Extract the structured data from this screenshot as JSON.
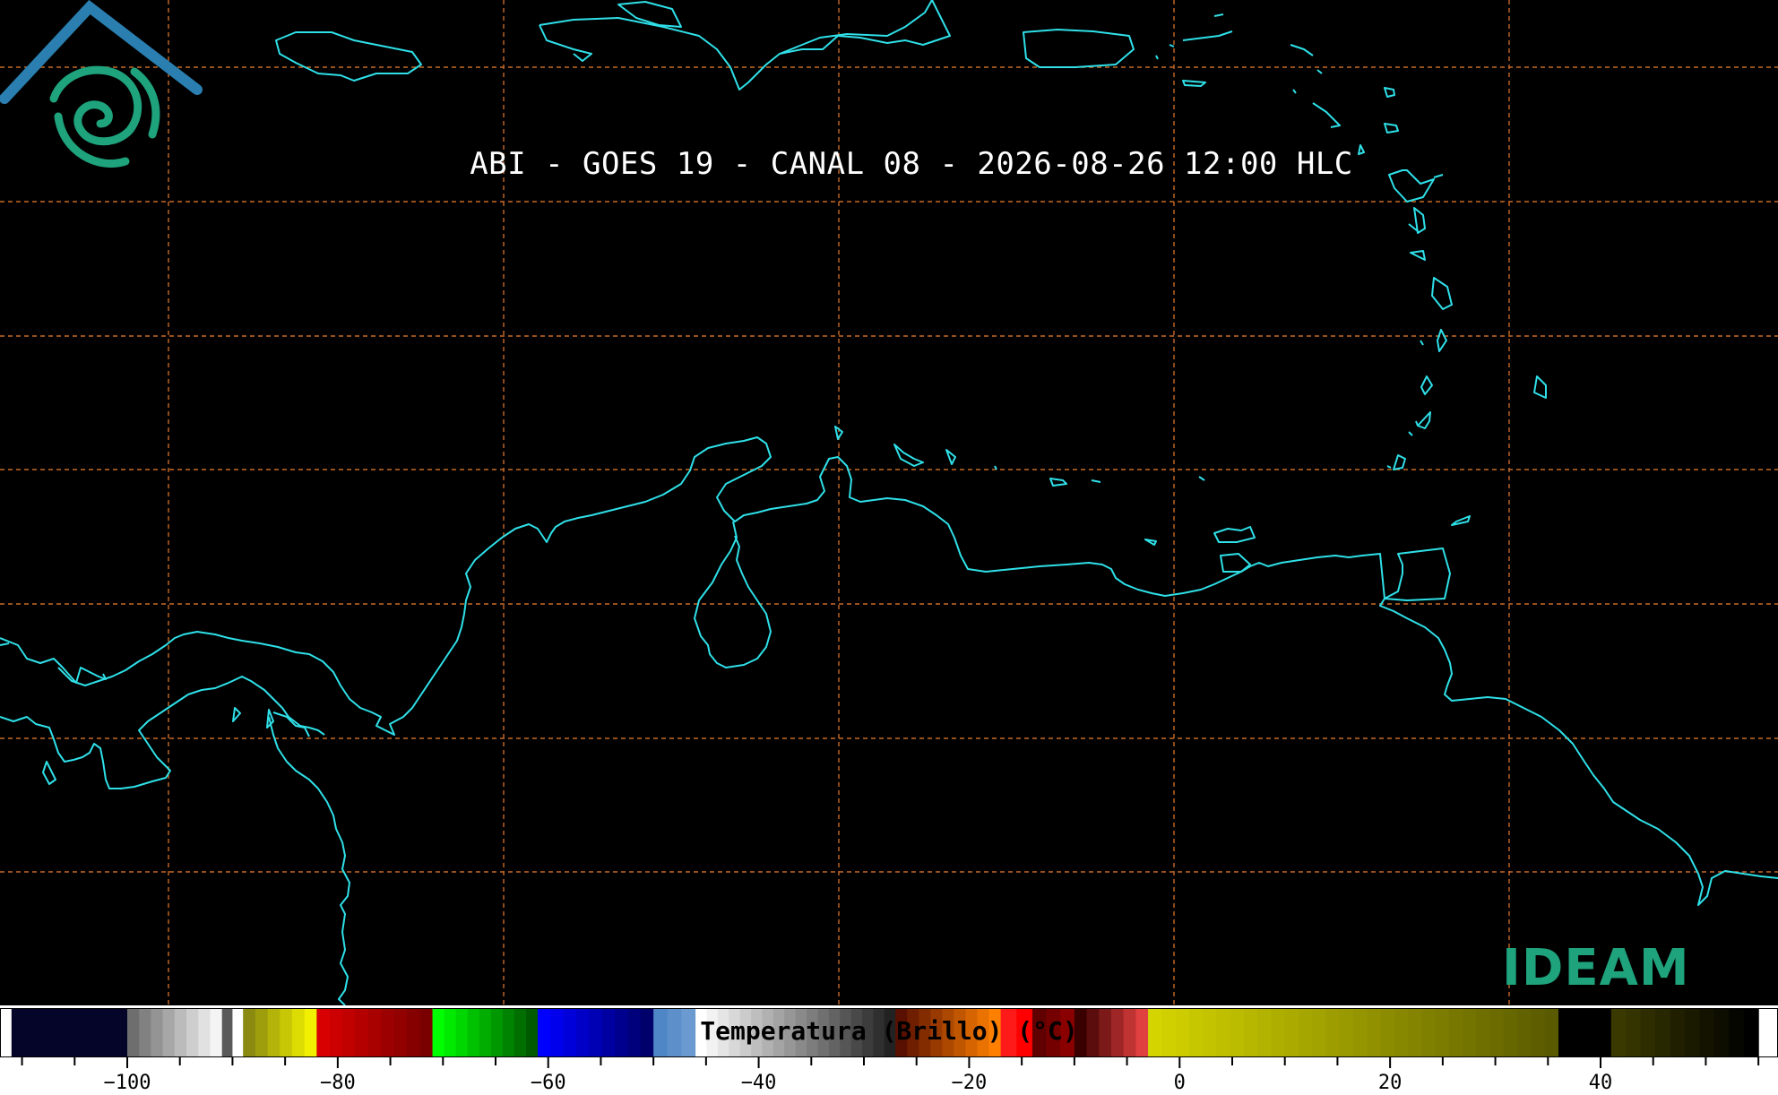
{
  "title": "ABI - GOES 19 - CANAL 08 - 2026-08-26 12:00 HLC",
  "logo": {
    "text": "IDEAM"
  },
  "colorbar": {
    "label": "Temperatura (Brillo) (°C)",
    "ticks": [
      "−100",
      "−80",
      "−60",
      "−40",
      "−20",
      "0",
      "20",
      "40"
    ],
    "tick_values": [
      -100,
      -80,
      -60,
      -40,
      -20,
      0,
      20,
      40
    ],
    "range": [
      -112,
      55
    ]
  },
  "colors": {
    "coastline": "#2fe0e8",
    "gridline": "#c86a28",
    "logo_blue": "#2a7fb0",
    "logo_green": "#1fa37c"
  }
}
